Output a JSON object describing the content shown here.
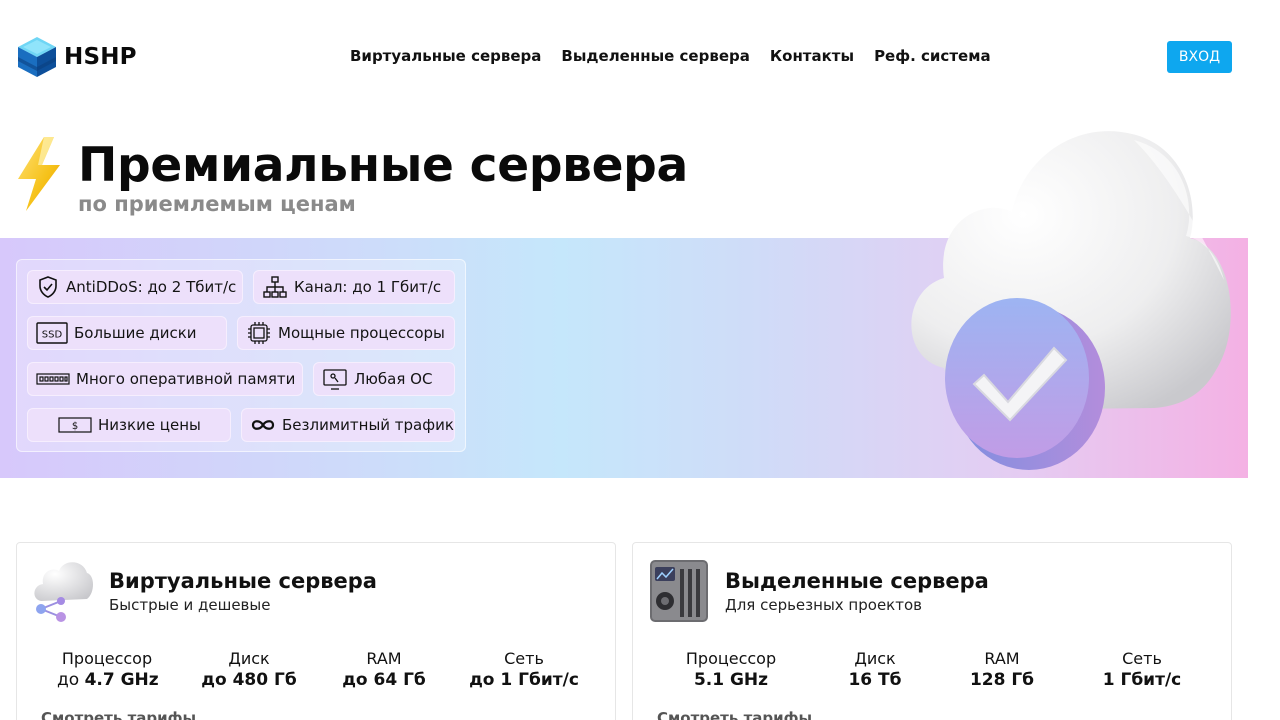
{
  "brand": {
    "name": "HSHP"
  },
  "nav": {
    "items": [
      {
        "label": "Виртуальные сервера"
      },
      {
        "label": "Выделенные сервера"
      },
      {
        "label": "Контакты"
      },
      {
        "label": "Реф. система"
      }
    ],
    "login_label": "ВХОД"
  },
  "hero": {
    "title": "Премиальные сервера",
    "subtitle": "по приемлемым ценам"
  },
  "features": [
    {
      "icon": "shield-icon",
      "label": "AntiDDoS: до 2 Тбит/с"
    },
    {
      "icon": "network-icon",
      "label": "Канал: до 1 Гбит/с"
    },
    {
      "icon": "ssd-icon",
      "label": "Большие диски",
      "icon_text": "SSD"
    },
    {
      "icon": "cpu-icon",
      "label": "Мощные процессоры"
    },
    {
      "icon": "ram-icon",
      "label": "Много оперативной памяти"
    },
    {
      "icon": "os-icon",
      "label": "Любая ОС"
    },
    {
      "icon": "banknote-icon",
      "label": "Низкие цены",
      "icon_text": "$"
    },
    {
      "icon": "infinity-icon",
      "label": "Безлимитный трафик"
    }
  ],
  "cards": [
    {
      "title": "Виртуальные сервера",
      "description": "Быстрые и дешевые",
      "specs": [
        {
          "label": "Процессор",
          "prefix": "до ",
          "value": "4.7 GHz"
        },
        {
          "label": "Диск",
          "prefix": "",
          "value": "до 480 Гб"
        },
        {
          "label": "RAM",
          "prefix": "",
          "value": "до 64 Гб"
        },
        {
          "label": "Сеть",
          "prefix": "",
          "value": "до 1 Гбит/с"
        }
      ],
      "link": "Смотреть тарифы"
    },
    {
      "title": "Выделенные сервера",
      "description": "Для серьезных проектов",
      "specs": [
        {
          "label": "Процессор",
          "prefix": "",
          "value": "5.1 GHz"
        },
        {
          "label": "Диск",
          "prefix": "",
          "value": "16 Тб"
        },
        {
          "label": "RAM",
          "prefix": "",
          "value": "128 Гб"
        },
        {
          "label": "Сеть",
          "prefix": "",
          "value": "1 Гбит/с"
        }
      ],
      "link": "Смотреть тарифы"
    }
  ],
  "colors": {
    "accent": "#0ea7ef",
    "title_gray": "#8a8a8a",
    "pill_bg": "#ede0fb"
  }
}
